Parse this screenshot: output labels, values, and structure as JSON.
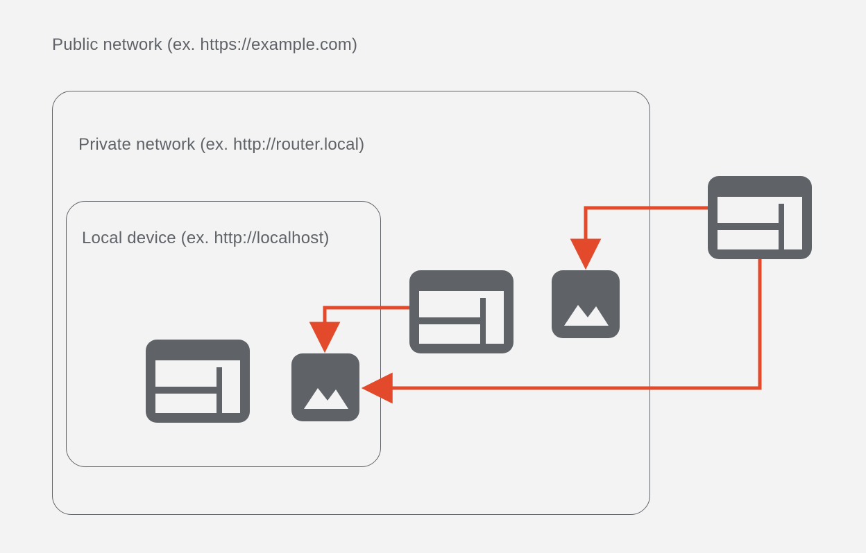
{
  "diagram": {
    "public_label": "Public network (ex. https://example.com)",
    "private_label": "Private network (ex. http://router.local)",
    "local_label": "Local device (ex. http://localhost)",
    "colors": {
      "icon_fill": "#5f6368",
      "arrow": "#e24a2b",
      "border": "#5f6368",
      "bg": "#f3f3f3"
    },
    "nodes": {
      "public_browser": "browser window icon (public network)",
      "private_browser": "browser window icon (private network)",
      "private_image": "image/photo icon (private network target)",
      "local_browser": "browser window icon (local device)",
      "local_image": "image/photo icon (local device target)"
    },
    "arrows": [
      "public_browser → private_image (fetch into private network)",
      "public_browser → local_image (fetch into local device)",
      "private_browser → local_image (fetch into local device)"
    ]
  }
}
